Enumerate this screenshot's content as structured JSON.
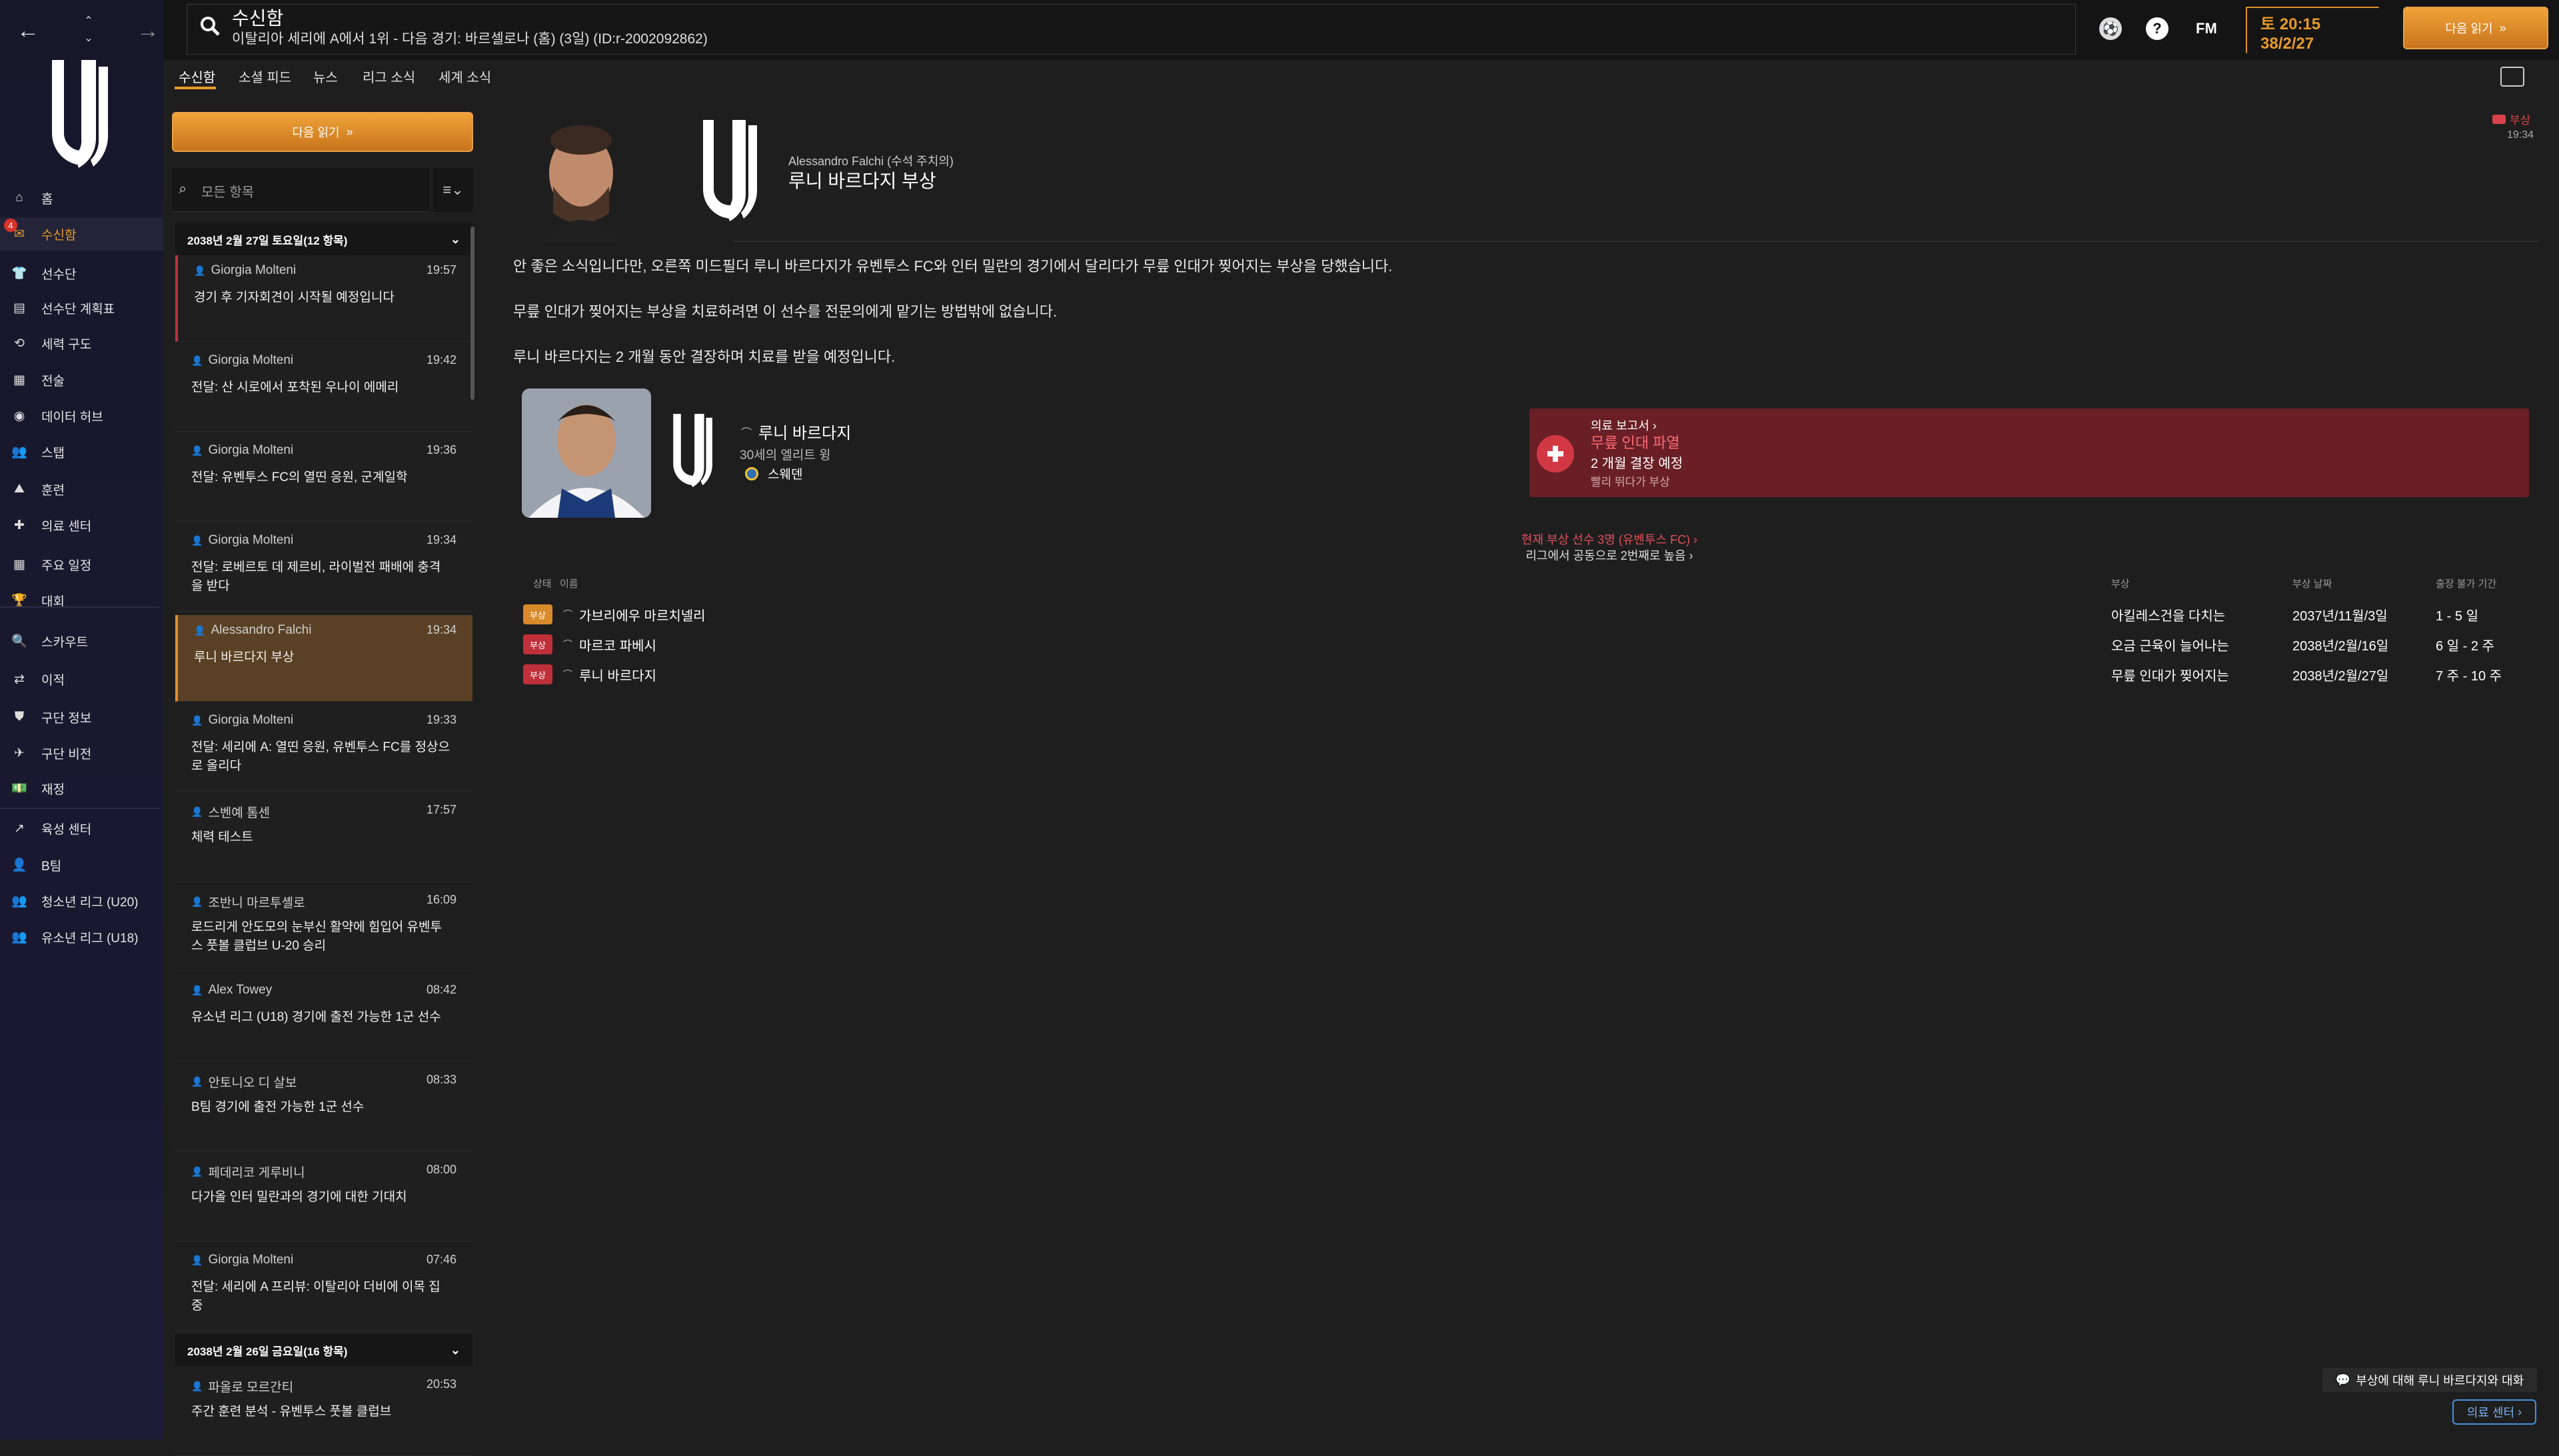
{
  "topbar": {
    "title": "수신함",
    "subtitle": "이탈리아 세리에 A에서 1위 - 다음 경기: 바르셀로나 (홈) (3일) (ID:r-2002092862)",
    "fm_label": "FM",
    "time": "토 20:15",
    "date": "38/2/27",
    "next_button": "다음 읽기"
  },
  "nav": {
    "items": [
      {
        "label": "홈",
        "icon": "home-icon"
      },
      {
        "label": "수신함",
        "icon": "inbox-icon",
        "badge": "4"
      },
      {
        "label": "선수단",
        "icon": "shirt-icon"
      },
      {
        "label": "선수단 계획표",
        "icon": "clipboard-icon"
      },
      {
        "label": "세력 구도",
        "icon": "dynamics-icon"
      },
      {
        "label": "전술",
        "icon": "tactics-icon"
      },
      {
        "label": "데이터 허브",
        "icon": "data-hub-icon"
      },
      {
        "label": "스탭",
        "icon": "staff-icon"
      },
      {
        "label": "훈련",
        "icon": "training-icon"
      },
      {
        "label": "의료 센터",
        "icon": "medical-icon"
      },
      {
        "label": "주요 일정",
        "icon": "calendar-icon"
      },
      {
        "label": "대회",
        "icon": "trophy-icon"
      },
      {
        "label": "스카우트",
        "icon": "scout-icon"
      },
      {
        "label": "이적",
        "icon": "transfer-icon"
      },
      {
        "label": "구단 정보",
        "icon": "shield-icon"
      },
      {
        "label": "구단 비전",
        "icon": "vision-icon"
      },
      {
        "label": "재정",
        "icon": "finance-icon"
      },
      {
        "label": "육성 센터",
        "icon": "development-icon"
      },
      {
        "label": "B팀",
        "icon": "team-b-icon"
      },
      {
        "label": "청소년 리그 (U20)",
        "icon": "u20-icon"
      },
      {
        "label": "유소년 리그 (U18)",
        "icon": "u18-icon"
      }
    ]
  },
  "tabs": [
    "수신함",
    "소셜 피드",
    "뉴스",
    "리그 소식",
    "세계 소식"
  ],
  "list": {
    "next_button": "다음 읽기",
    "search_placeholder": "모든 항목",
    "day1": "2038년 2월 27일 토요일(12 항목)",
    "day2": "2038년 2월 26일 금요일(16 항목)",
    "messages": [
      {
        "sender": "Giorgia Molteni",
        "time": "19:57",
        "subject": "경기 후 기자회견이 시작될 예정입니다"
      },
      {
        "sender": "Giorgia Molteni",
        "time": "19:42",
        "subject": "전달: 산 시로에서 포착된 우나이 에메리"
      },
      {
        "sender": "Giorgia Molteni",
        "time": "19:36",
        "subject": "전달: 유벤투스 FC의 열띤 응원, 군계일학"
      },
      {
        "sender": "Giorgia Molteni",
        "time": "19:34",
        "subject": "전달: 로베르토 데 제르비, 라이벌전 패배에 충격을 받다"
      },
      {
        "sender": "Alessandro Falchi",
        "time": "19:34",
        "subject": "루니 바르다지 부상"
      },
      {
        "sender": "Giorgia Molteni",
        "time": "19:33",
        "subject": "전달: 세리에 A: 열띤 응원, 유벤투스 FC를 정상으로 올리다"
      },
      {
        "sender": "스벤예 톰센",
        "time": "17:57",
        "subject": "체력 테스트"
      },
      {
        "sender": "조반니 마르투셸로",
        "time": "16:09",
        "subject": "로드리게 안도모의 눈부신 활약에 힘입어 유벤투스 풋볼 클럽브 U-20 승리"
      },
      {
        "sender": "Alex Towey",
        "time": "08:42",
        "subject": "유소년 리그 (U18) 경기에 출전 가능한 1군 선수"
      },
      {
        "sender": "안토니오 디 살보",
        "time": "08:33",
        "subject": "B팀 경기에 출전 가능한 1군 선수"
      },
      {
        "sender": "페데리코 게루비니",
        "time": "08:00",
        "subject": "다가올 인터 밀란과의 경기에 대한 기대치"
      },
      {
        "sender": "Giorgia Molteni",
        "time": "07:46",
        "subject": "전달: 세리에 A 프리뷰: 이탈리아 더비에 이목 집중"
      },
      {
        "sender": "파올로 모르간티",
        "time": "20:53",
        "subject": "주간 훈련 분석 - 유벤투스 풋볼 클럽브"
      }
    ]
  },
  "message": {
    "sender_line": "Alessandro Falchi (수석 주치의)",
    "title": "루니 바르다지 부상",
    "tag": "부상",
    "time": "19:34",
    "para1": "안 좋은 소식입니다만, 오른쪽 미드필더 루니 바르다지가 유벤투스 FC와 인터 밀란의 경기에서 달리다가 무릎 인대가 찢어지는 부상을 당했습니다.",
    "para2": "무릎 인대가 찢어지는 부상을 치료하려면 이 선수를 전문의에게 맡기는 방법밖에 없습니다.",
    "para3": "루니 바르다지는 2 개월 동안 결장하며 치료를 받을 예정입니다.",
    "player": {
      "name": "루니 바르다지",
      "desc": "30세의 엘리트 윙",
      "nation": "스웨덴"
    },
    "medical": {
      "link": "의료 보고서",
      "injury": "무릎 인대 파열",
      "duration": "2 개월 결장 예정",
      "note": "빨리 뛰다가 부상"
    },
    "summary_line1": "현재 부상 선수 3명 (유벤투스 FC)",
    "summary_line2": "리그에서 공동으로 2번째로 높음",
    "table": {
      "headers": [
        "상태",
        "이름",
        "부상",
        "부상 날짜",
        "출장 불가 기간"
      ],
      "rows": [
        {
          "tag": "부상",
          "tag_color": "#d98a2a",
          "name": "가브리에우 마르치넬리",
          "injury": "아킬레스건을 다치는",
          "date": "2037년/11월/3일",
          "period": "1 - 5 일"
        },
        {
          "tag": "부상",
          "tag_color": "#c0303a",
          "name": "마르코 파베시",
          "injury": "오금 근육이 늘어나는",
          "date": "2038년/2월/16일",
          "period": "6 일 - 2 주"
        },
        {
          "tag": "부상",
          "tag_color": "#c0303a",
          "name": "루니 바르다지",
          "injury": "무릎 인대가 찢어지는",
          "date": "2038년/2월/27일",
          "period": "7 주 - 10 주"
        }
      ]
    },
    "discuss_button": "부상에 대해 루니 바르다지와 대화",
    "medical_center_button": "의료 센터"
  }
}
